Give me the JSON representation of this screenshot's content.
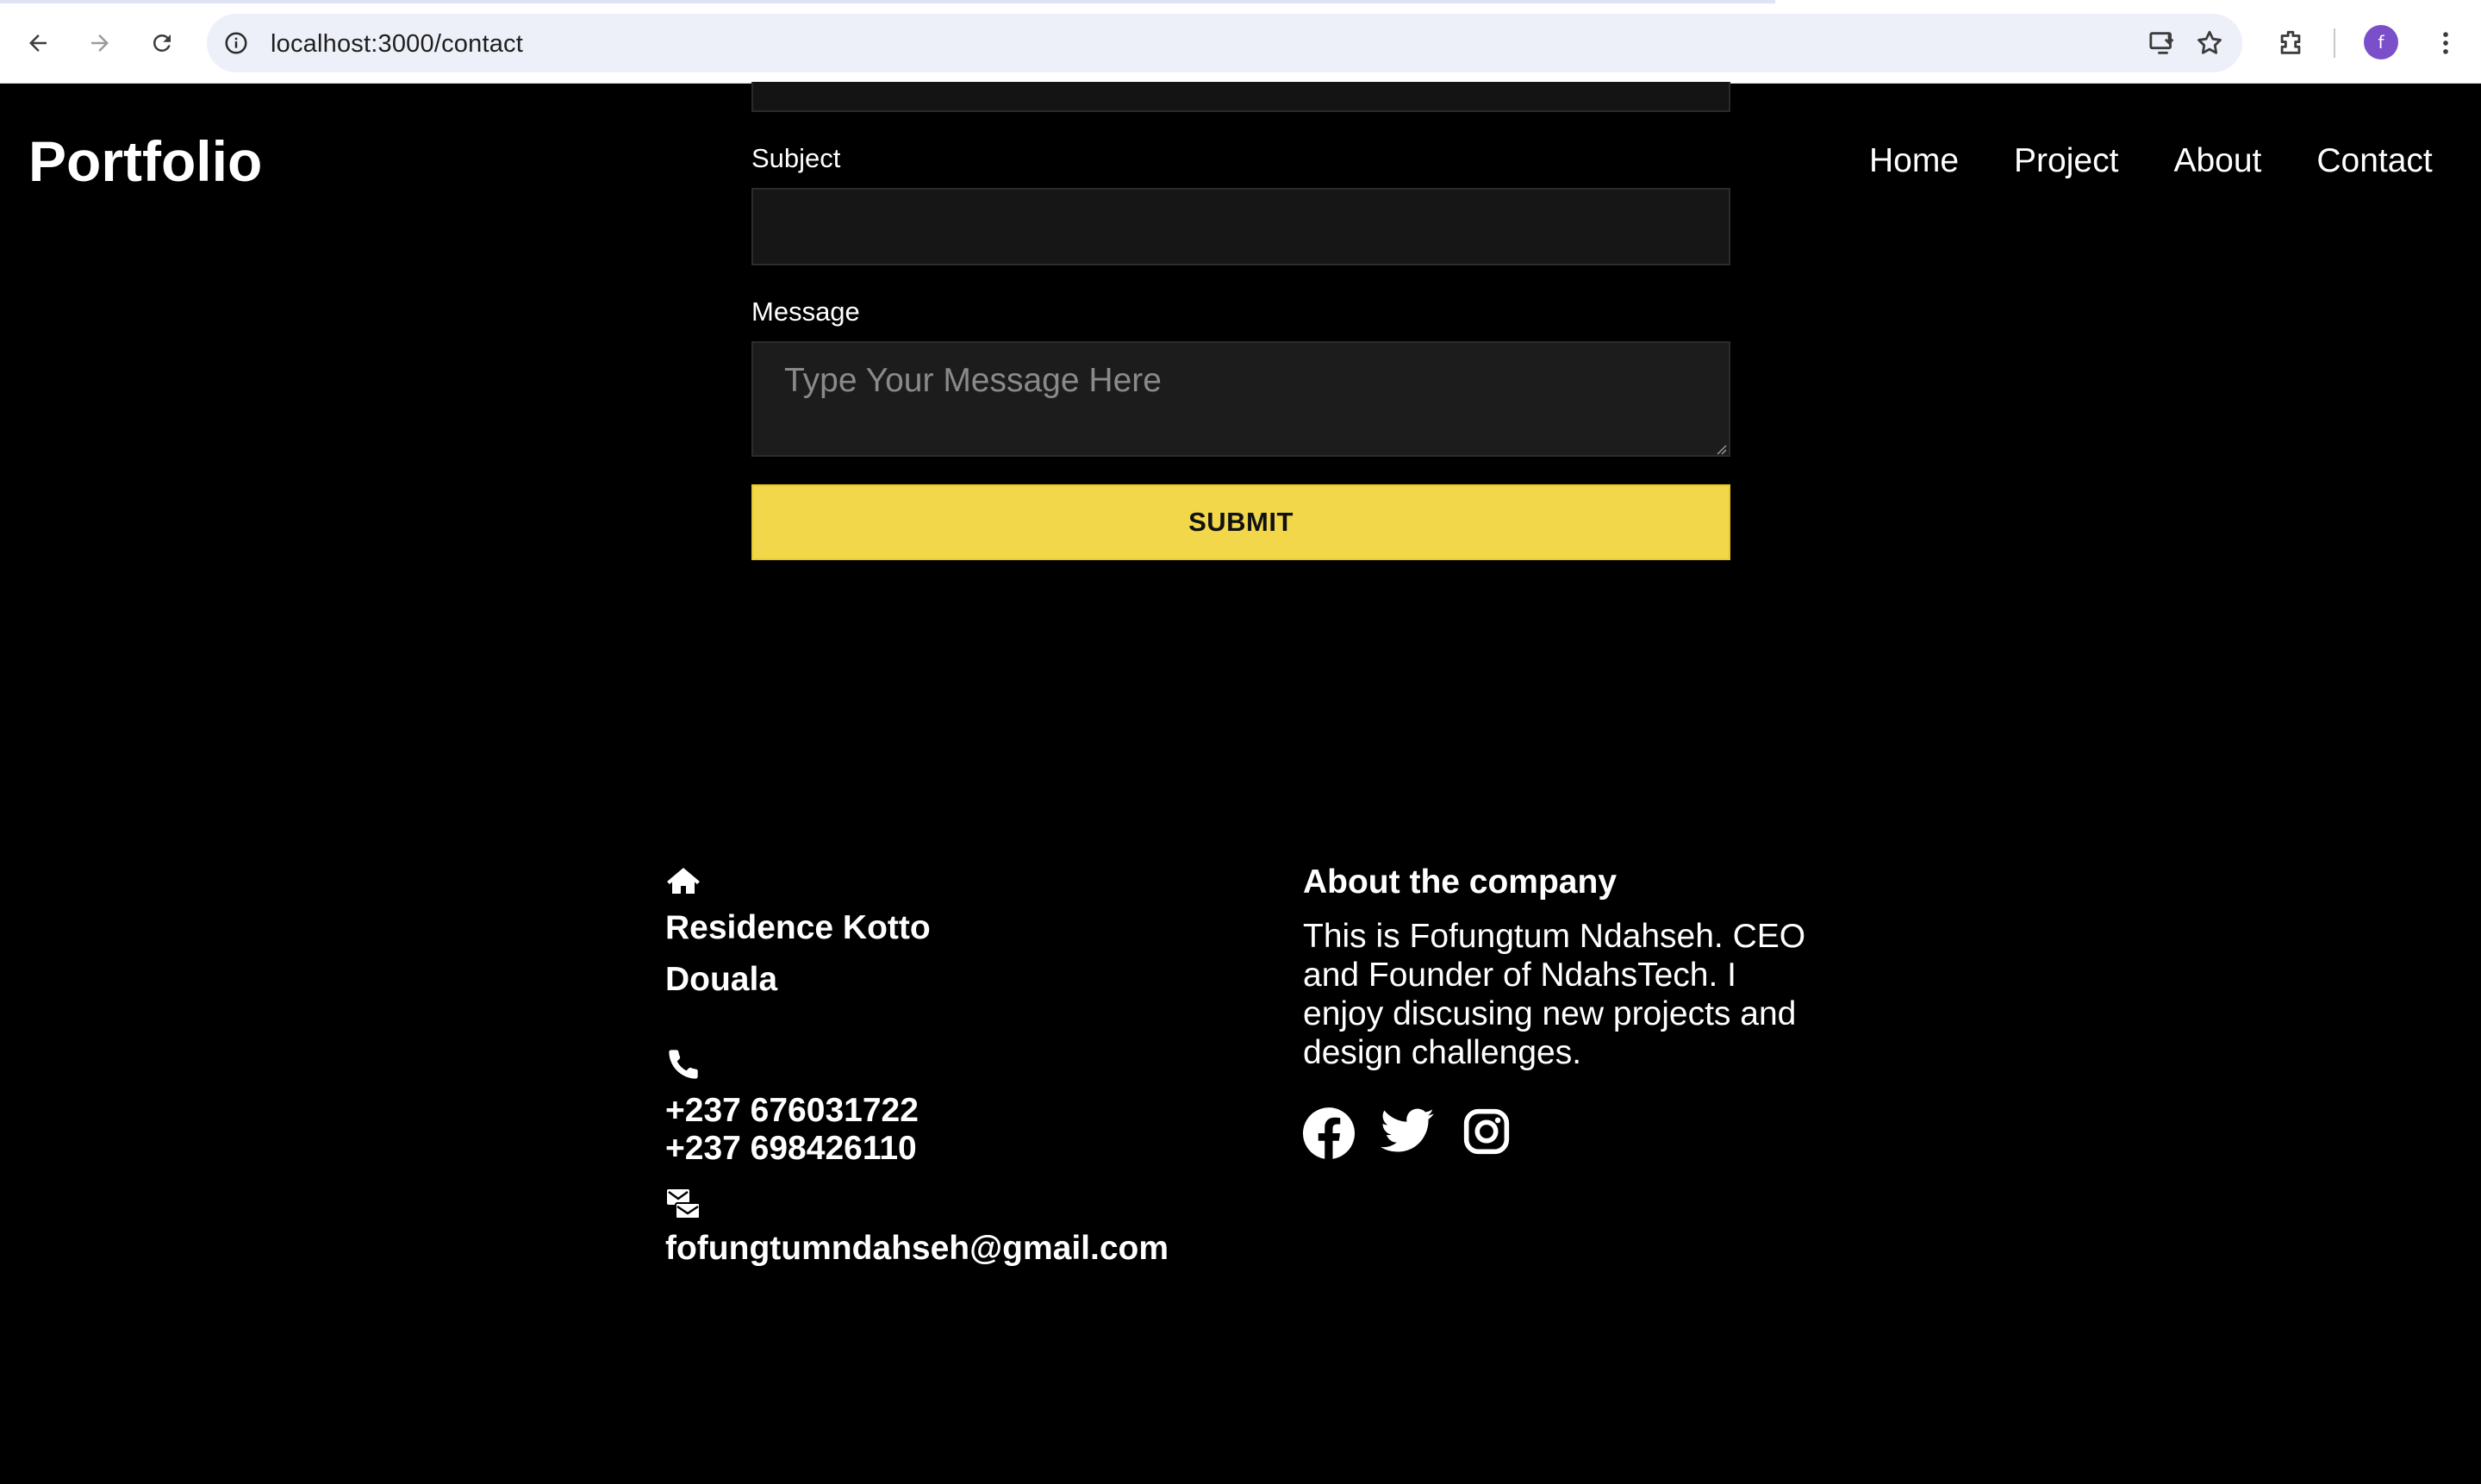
{
  "browser": {
    "url": "localhost:3000/contact",
    "profile_initial": "f"
  },
  "header": {
    "brand": "Portfolio",
    "nav": [
      "Home",
      "Project",
      "About",
      "Contact"
    ]
  },
  "form": {
    "subject_label": "Subject",
    "subject_value": "",
    "message_label": "Message",
    "message_placeholder": "Type Your Message Here",
    "submit_label": "SUBMIT"
  },
  "footer": {
    "address_line1": "Residence Kotto",
    "address_line2": "Douala",
    "phone1": "+237 676031722",
    "phone2": "+237 698426110",
    "email": "fofungtumndahseh@gmail.com",
    "about_title": "About the company",
    "about_text": "This is Fofungtum Ndahseh. CEO and Founder of NdahsTech. I enjoy discusing new projects and design challenges."
  },
  "icons": {
    "address": "home-icon",
    "phone": "phone-icon",
    "email": "mail-icon",
    "social": [
      "facebook-icon",
      "twitter-icon",
      "instagram-icon"
    ]
  },
  "colors": {
    "background": "#000000",
    "accent": "#f2d74a",
    "text": "#ffffff"
  }
}
